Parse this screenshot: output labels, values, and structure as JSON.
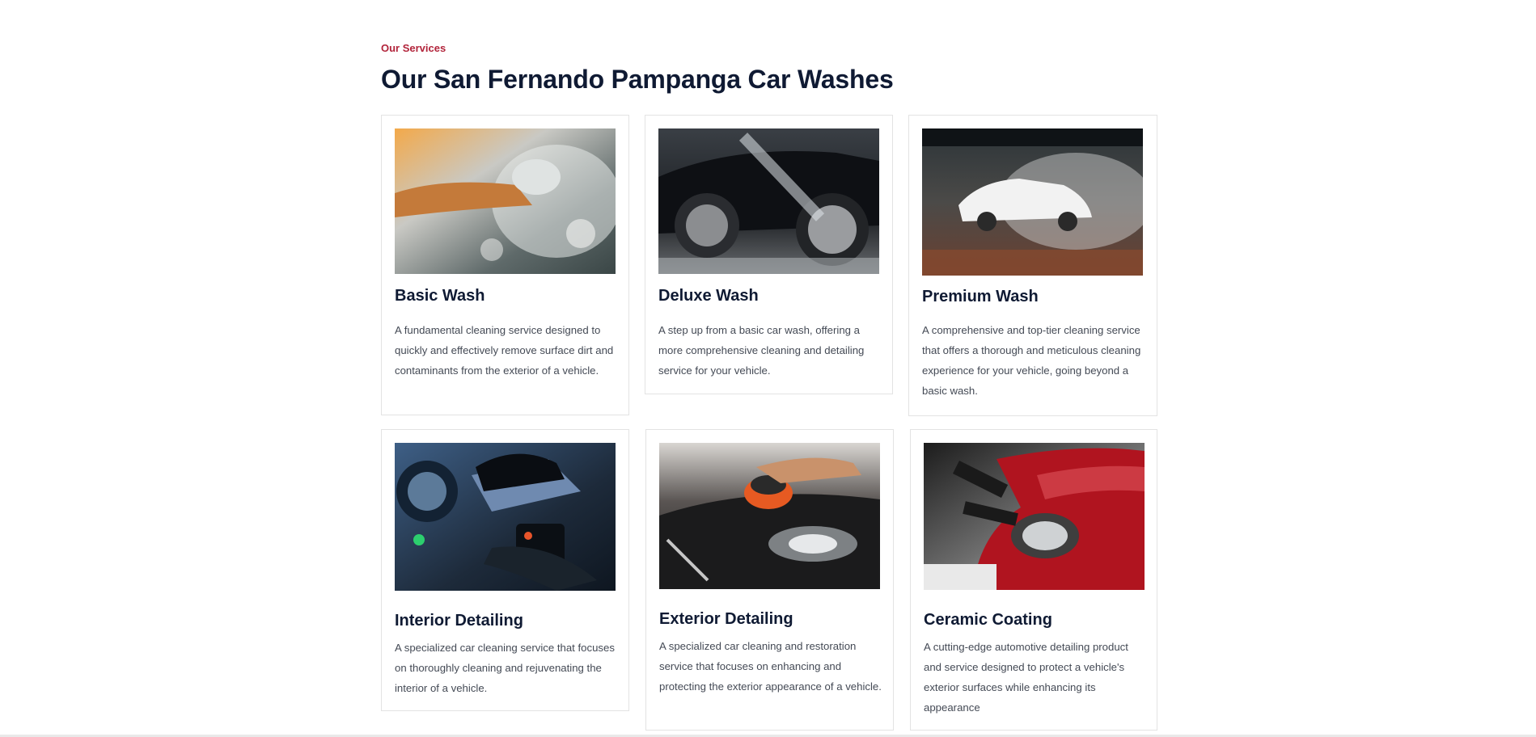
{
  "section": {
    "eyebrow": "Our Services",
    "heading": "Our San Fernando Pampanga Car Washes"
  },
  "services": [
    {
      "title": "Basic Wash",
      "description": "A fundamental cleaning service designed to quickly and effectively remove surface dirt and contaminants from the exterior of a vehicle."
    },
    {
      "title": "Deluxe Wash",
      "description": "A step up from a basic car wash, offering a more comprehensive cleaning and detailing service for your vehicle."
    },
    {
      "title": "Premium Wash",
      "description": "A comprehensive and top-tier cleaning service that offers a thorough and meticulous cleaning experience for your vehicle, going beyond a basic wash."
    },
    {
      "title": "Interior Detailing",
      "description": "A specialized car cleaning service that focuses on thoroughly cleaning and rejuvenating the interior of a vehicle."
    },
    {
      "title": "Exterior Detailing",
      "description": "A specialized car cleaning and restoration service that focuses on enhancing and protecting the exterior appearance of a vehicle."
    },
    {
      "title": "Ceramic Coating",
      "description": "A cutting-edge automotive detailing product and service designed to protect a vehicle's exterior surfaces while enhancing its appearance"
    }
  ]
}
